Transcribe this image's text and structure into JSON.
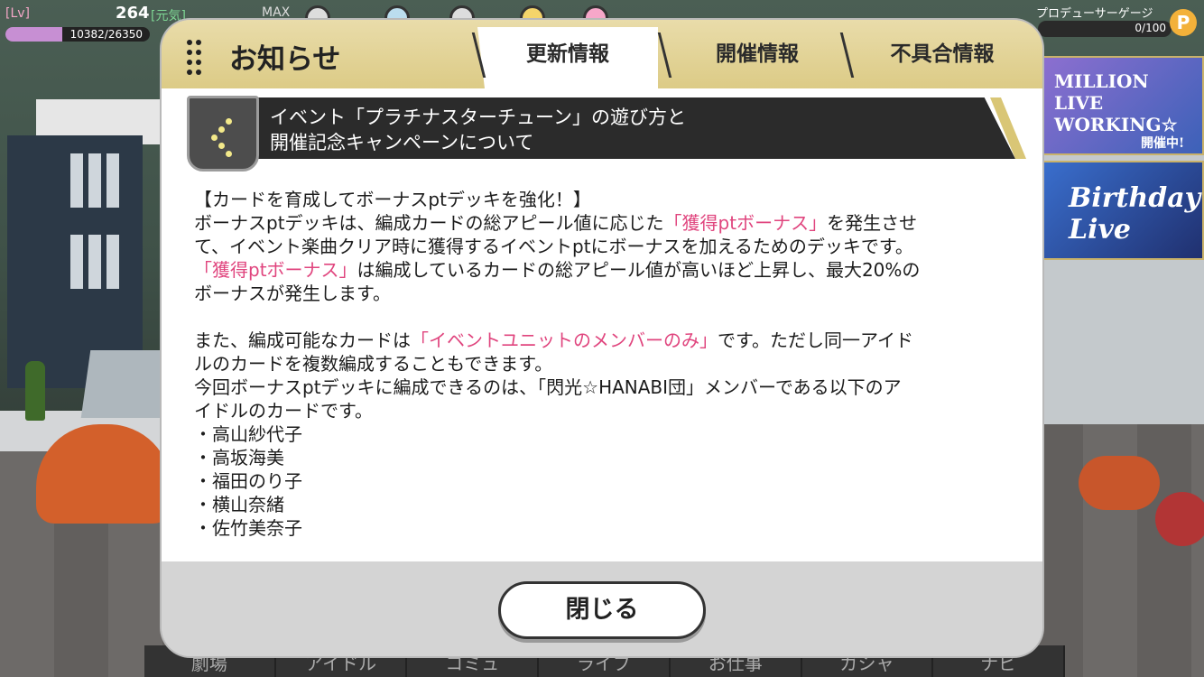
{
  "hud": {
    "level_tag": "[Lv]",
    "level": "264",
    "genki_tag": "[元気]",
    "max_label": "MAX",
    "exp_text": "10382/26350",
    "exp_fraction": 0.394,
    "producer_gauge_label": "プロデューサーゲージ",
    "producer_gauge_value": "0/100",
    "coin_icon": "P"
  },
  "dialog": {
    "title": "お知らせ",
    "tabs": [
      {
        "label": "更新情報",
        "active": true
      },
      {
        "label": "開催情報",
        "active": false
      },
      {
        "label": "不具合情報",
        "active": false
      }
    ],
    "subheader": {
      "line1": "イベント「プラチナスターチューン」の遊び方と",
      "line2": "開催記念キャンペーンについて"
    },
    "paragraphs": {
      "p1": "【カードを育成してボーナスptデッキを強化！】",
      "p2a": "ボーナスptデッキは、編成カードの総アピール値に応じた",
      "p2b": "「獲得ptボーナス」",
      "p2c": "を発生させ",
      "p3": "て、イベント楽曲クリア時に獲得するイベントptにボーナスを加えるためのデッキです。",
      "p4a": "「獲得ptボーナス」",
      "p4b": "は編成しているカードの総アピール値が高いほど上昇し、最大20%の",
      "p5": "ボーナスが発生します。",
      "p6a": "また、編成可能なカードは",
      "p6b": "「イベントユニットのメンバーのみ」",
      "p6c": "です。ただし同一アイド",
      "p7": "ルのカードを複数編成することもできます。",
      "p8": "今回ボーナスptデッキに編成できるのは、「閃光☆HANABI団」メンバーである以下のア",
      "p9": "イドルのカードです。"
    },
    "idols": [
      "・高山紗代子",
      "・高坂海美",
      "・福田のり子",
      "・横山奈緒",
      "・佐竹美奈子"
    ],
    "close_label": "閉じる"
  },
  "bottom_nav": [
    "劇場",
    "アイドル",
    "コミュ",
    "ライブ",
    "お仕事",
    "ガシャ",
    "ナビ"
  ],
  "banners": {
    "banner1": "MILLION LIVE WORKING☆",
    "banner1_badge": "開催中!",
    "banner2": "Birthday Live"
  },
  "colors": {
    "accent_pink": "#e0457e",
    "header_gold": "#dccb86",
    "subheader_dark": "#2b2b2b"
  }
}
